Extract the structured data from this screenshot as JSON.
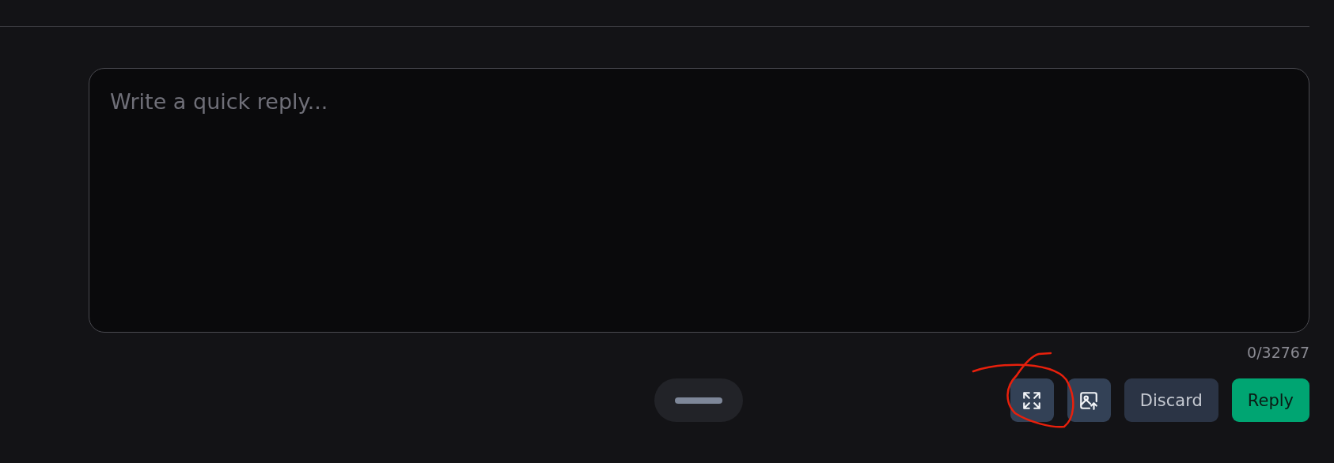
{
  "composer": {
    "placeholder": "Write a quick reply...",
    "counter": "0/32767"
  },
  "toolbar": {
    "buttons": [
      {
        "kind": "expand"
      },
      {
        "kind": "image"
      },
      {
        "kind": "text",
        "label": "Discard"
      },
      {
        "kind": "primary",
        "label": "Reply"
      }
    ]
  }
}
